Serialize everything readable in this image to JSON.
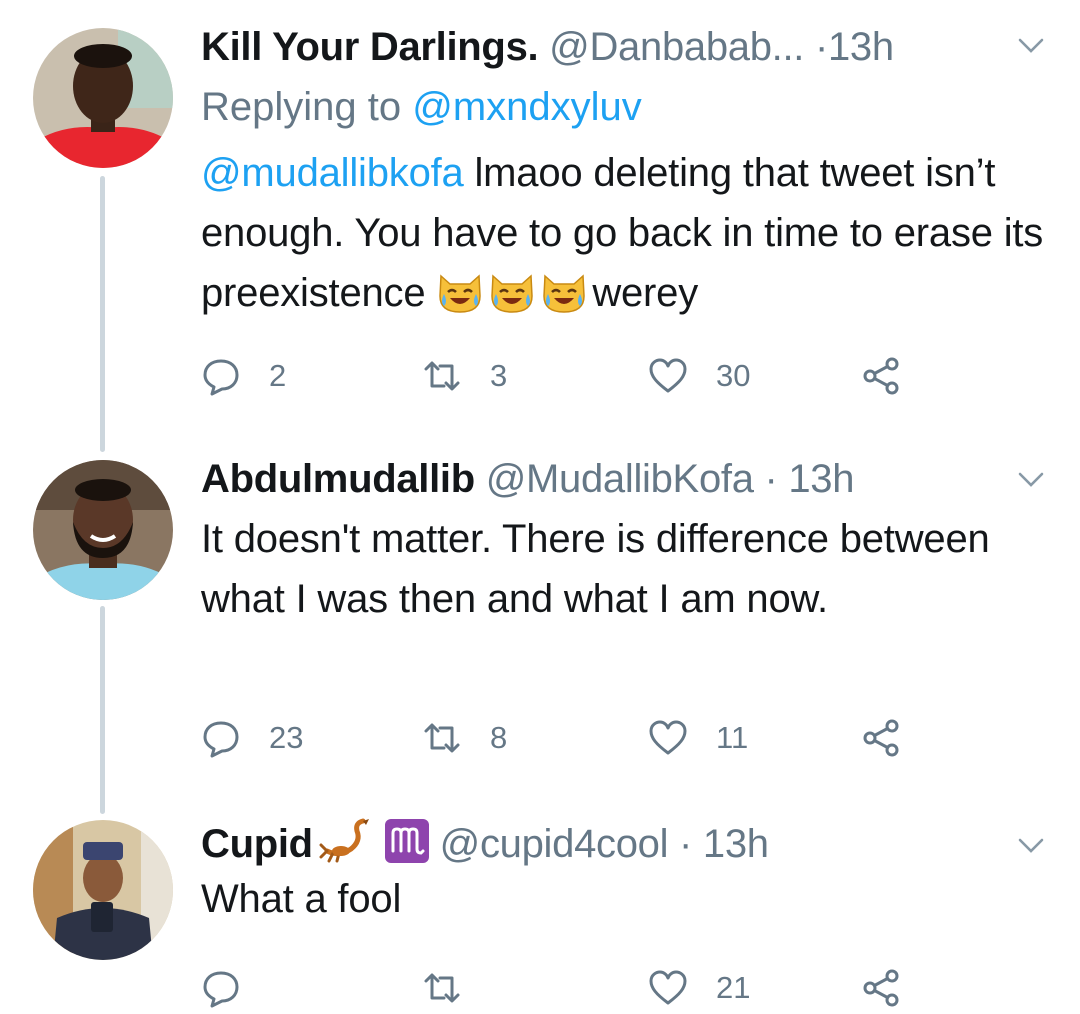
{
  "tweets": [
    {
      "display_name": "Kill Your Darlings.",
      "handle": "@Danbabab...",
      "time_sep": "·",
      "time": "13h",
      "replying_prefix": "Replying to",
      "replying_handle": "@mxndxyluv",
      "body_mention": "@mudallibkofa",
      "body_text_1": " lmaoo deleting that tweet isn’t enough. You have to go back in time to erase its preexistence ",
      "body_text_2": "werey",
      "body_emoji": "crying-laughing-cat-face ×3",
      "reply_count": "2",
      "retweet_count": "3",
      "like_count": "30"
    },
    {
      "display_name": "Abdulmudallib",
      "handle": "@MudallibKofa",
      "time_sep": "·",
      "time": "13h",
      "body_text": "It doesn't matter. There is difference between what I was then and what I am now.",
      "reply_count": "23",
      "retweet_count": "8",
      "like_count": "11"
    },
    {
      "display_name": "Cupid",
      "name_emoji": "scorpion, scorpius-sign",
      "handle": "@cupid4cool",
      "time_sep": "·",
      "time": "13h",
      "body_text": "What a fool",
      "reply_count": "",
      "retweet_count": "",
      "like_count": "21"
    }
  ],
  "colors": {
    "text": "#14171a",
    "secondary": "#657786",
    "link": "#1da1f2",
    "thread_line": "#ccd6dd"
  }
}
